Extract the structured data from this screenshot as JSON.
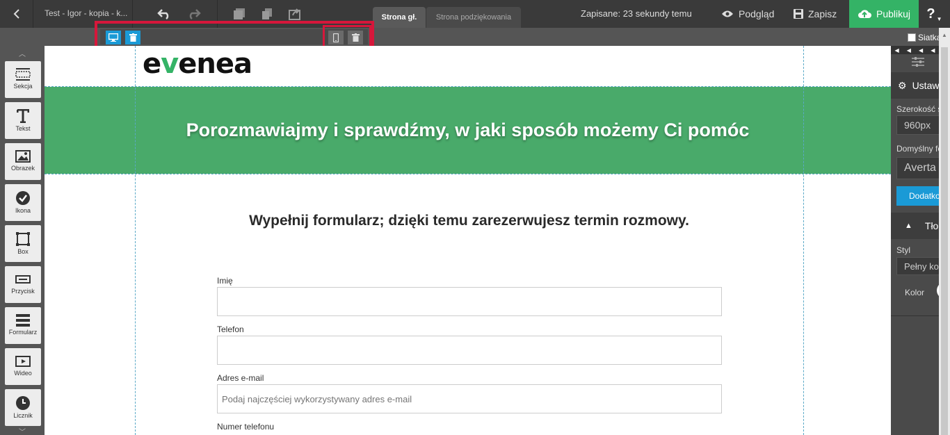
{
  "topbar": {
    "doc_title": "Test - Igor - kopia - k...",
    "tabs": [
      {
        "label": "Strona gł.",
        "active": true
      },
      {
        "label": "Strona podziękowania",
        "active": false
      }
    ],
    "saved_status": "Zapisane: 23 sekundy temu",
    "preview_label": "Podgląd",
    "save_label": "Zapisz",
    "publish_label": "Publikuj",
    "help_label": "?"
  },
  "subbar": {
    "grid_label": "Siatka"
  },
  "sidebar": {
    "tools": [
      {
        "label": "Sekcja",
        "icon": "section-icon"
      },
      {
        "label": "Tekst",
        "icon": "text-icon"
      },
      {
        "label": "Obrazek",
        "icon": "image-icon"
      },
      {
        "label": "Ikona",
        "icon": "check-circle-icon"
      },
      {
        "label": "Box",
        "icon": "box-icon"
      },
      {
        "label": "Przycisk",
        "icon": "button-icon"
      },
      {
        "label": "Formularz",
        "icon": "form-icon"
      },
      {
        "label": "Wideo",
        "icon": "video-icon"
      },
      {
        "label": "Licznik",
        "icon": "clock-icon"
      }
    ]
  },
  "canvas": {
    "logo_text_1": "e",
    "logo_text_2": "v",
    "logo_text_3": "enea",
    "hero_title": "Porozmawiajmy i sprawdźmy, w jaki sposób możemy Ci pomóc",
    "form_title": "Wypełnij formularz; dzięki temu zarezerwujesz termin rozmowy.",
    "fields": [
      {
        "label": "Imię",
        "placeholder": ""
      },
      {
        "label": "Telefon",
        "placeholder": ""
      },
      {
        "label": "Adres e-mail",
        "placeholder": "Podaj najczęściej wykorzystywany adres e-mail"
      },
      {
        "label": "Numer telefonu",
        "placeholder": ""
      }
    ],
    "colors": {
      "hero_bg": "#49aa6a",
      "accent": "#34b366",
      "highlight": "#d6173b"
    }
  },
  "rpanel": {
    "settings_header": "Ustaw",
    "width_label": "Szerokość s",
    "width_value": "960px",
    "font_label": "Domyślny fo",
    "font_value": "Averta",
    "extra_button": "Dodatko",
    "bg_header": "Tło",
    "style_label": "Styl",
    "style_value": "Pełny ko",
    "color_label": "Kolor"
  }
}
